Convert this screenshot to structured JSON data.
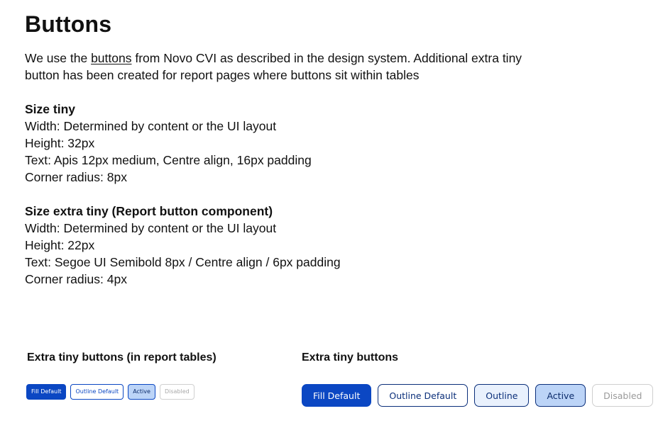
{
  "header": {
    "title": "Buttons"
  },
  "intro": {
    "text_before": "We use the ",
    "link_text": "buttons",
    "text_after": " from Novo CVI as described in the design system. Additional extra tiny button has been created for report pages where buttons sit within tables"
  },
  "spec_tiny": {
    "heading": "Size tiny",
    "lines": [
      "Width: Determined by content or the UI layout",
      "Height: 32px",
      "Text: Apis 12px medium, Centre align, 16px padding",
      "Corner radius: 8px"
    ]
  },
  "spec_extra_tiny": {
    "heading": "Size extra tiny (Report button component)",
    "lines": [
      "Width: Determined by content or the UI layout",
      "Height: 22px",
      "Text: Segoe UI Semibold 8px / Centre align / 6px padding",
      "Corner radius: 4px"
    ]
  },
  "report_buttons": {
    "title": "Extra tiny buttons (in report tables)",
    "fill_default": "Fill Default",
    "outline_default": "Outline Default",
    "active": "Active",
    "disabled": "Disabled"
  },
  "tiny_buttons": {
    "title": "Extra tiny buttons",
    "fill_default": "Fill Default",
    "outline_default": "Outline Default",
    "outline": "Outline",
    "active": "Active",
    "disabled": "Disabled"
  },
  "colors": {
    "primary": "#0b47c3",
    "navy": "#0b2f7a",
    "active_bg": "#bcd4f7",
    "soft_bg": "#e9f1fd",
    "disabled_text": "#a8a8a8"
  }
}
